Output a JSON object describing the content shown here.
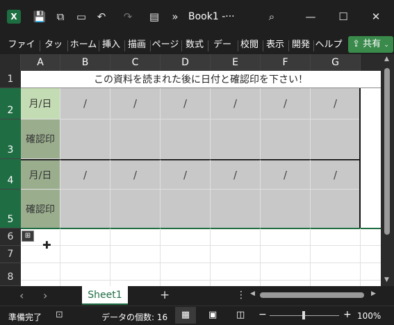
{
  "window": {
    "title": "Book1  -···"
  },
  "ribbon": {
    "tabs": [
      "ファイル",
      "タッチ",
      "ホーム",
      "挿入",
      "描画",
      "ページ",
      "数式",
      "データ",
      "校閲",
      "表示",
      "開発",
      "ヘルプ"
    ],
    "share_label": "共有"
  },
  "sheet": {
    "columns": [
      "A",
      "B",
      "C",
      "D",
      "E",
      "F",
      "G"
    ],
    "rows": [
      "1",
      "2",
      "3",
      "4",
      "5",
      "6",
      "7",
      "8"
    ],
    "banner": "この資料を読まれた後に日付と確認印を下さい！",
    "label_date": "月/日",
    "label_stamp": "確認印",
    "slash": "/"
  },
  "tabs_bar": {
    "sheet_tab": "Sheet1",
    "add": "+",
    "prev": "‹",
    "next": "›",
    "more": "⋮"
  },
  "status": {
    "ready": "準備完了",
    "count": "データの個数: 16",
    "zoom": "100%",
    "zoom_minus": "−",
    "zoom_plus": "+"
  }
}
